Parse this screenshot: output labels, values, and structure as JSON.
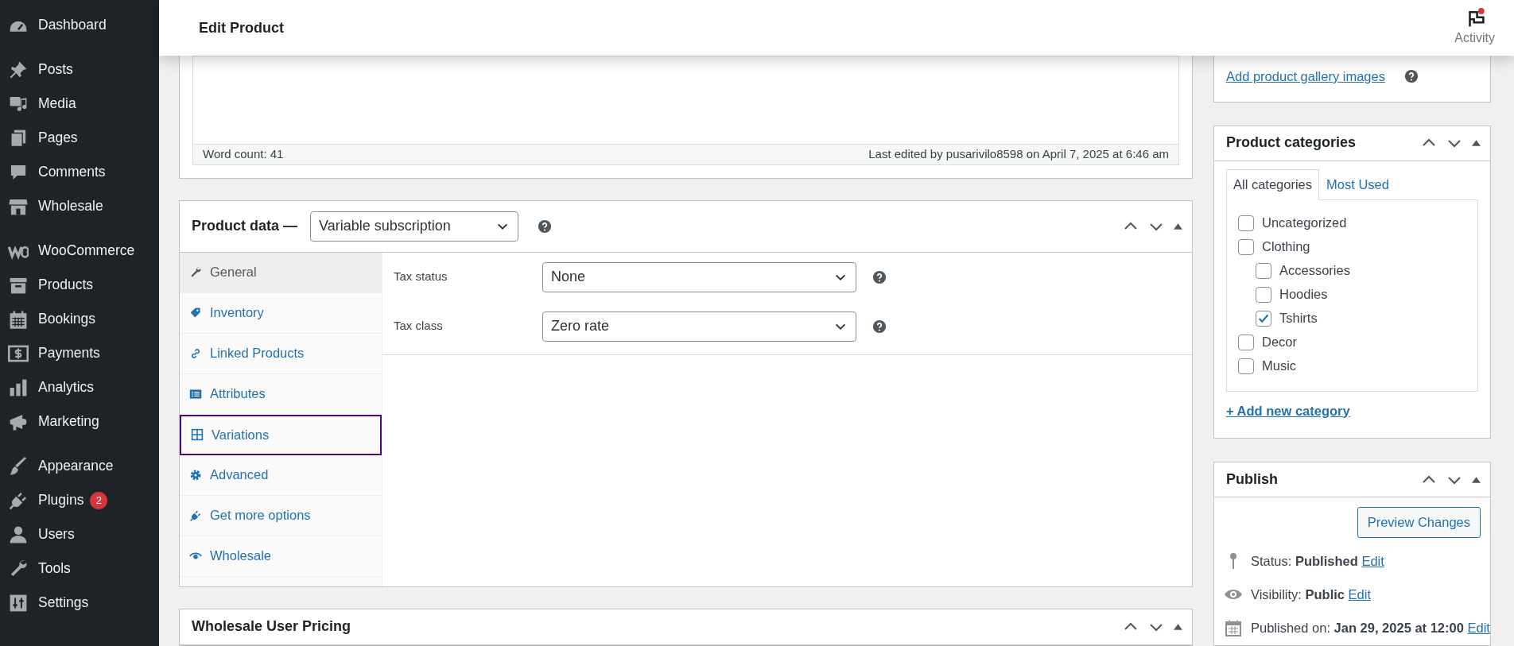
{
  "sidebar": {
    "groups": [
      {
        "items": [
          {
            "label": "Dashboard"
          }
        ]
      },
      {
        "items": [
          {
            "label": "Posts"
          },
          {
            "label": "Media"
          },
          {
            "label": "Pages"
          },
          {
            "label": "Comments"
          },
          {
            "label": "Wholesale"
          }
        ]
      },
      {
        "items": [
          {
            "label": "WooCommerce"
          },
          {
            "label": "Products"
          },
          {
            "label": "Bookings"
          },
          {
            "label": "Payments"
          },
          {
            "label": "Analytics"
          },
          {
            "label": "Marketing"
          }
        ]
      },
      {
        "items": [
          {
            "label": "Appearance"
          },
          {
            "label": "Plugins",
            "badge": "2"
          },
          {
            "label": "Users"
          },
          {
            "label": "Tools"
          },
          {
            "label": "Settings"
          }
        ]
      }
    ]
  },
  "header": {
    "title": "Edit Product",
    "activity": {
      "label": "Activity",
      "unread": true
    }
  },
  "editor": {
    "word_count": "Word count: 41",
    "last_edited": "Last edited by pusarivilo8598 on April 7, 2025 at 6:46 am"
  },
  "product_data": {
    "title": "Product data —",
    "type_select": "Variable subscription",
    "tabs": [
      {
        "label": "General",
        "selected": true,
        "focused": false
      },
      {
        "label": "Inventory",
        "selected": false,
        "focused": false
      },
      {
        "label": "Linked Products",
        "selected": false,
        "focused": false
      },
      {
        "label": "Attributes",
        "selected": false,
        "focused": false
      },
      {
        "label": "Variations",
        "selected": false,
        "focused": true
      },
      {
        "label": "Advanced",
        "selected": false,
        "focused": false
      },
      {
        "label": "Get more options",
        "selected": false,
        "focused": false
      },
      {
        "label": "Wholesale",
        "selected": false,
        "focused": false
      }
    ],
    "fields": [
      {
        "label": "Tax status",
        "value": "None"
      },
      {
        "label": "Tax class",
        "value": "Zero rate"
      }
    ]
  },
  "wholesale_pricing": {
    "title": "Wholesale User Pricing"
  },
  "gallery": {
    "link": "Add product gallery images"
  },
  "categories": {
    "title": "Product categories",
    "tabs": [
      {
        "label": "All categories",
        "selected": true
      },
      {
        "label": "Most Used",
        "selected": false
      }
    ],
    "items": [
      {
        "label": "Uncategorized",
        "checked": false
      },
      {
        "label": "Clothing",
        "checked": false,
        "children": [
          {
            "label": "Accessories",
            "checked": false
          },
          {
            "label": "Hoodies",
            "checked": false
          },
          {
            "label": "Tshirts",
            "checked": true
          }
        ]
      },
      {
        "label": "Decor",
        "checked": false
      },
      {
        "label": "Music",
        "checked": false
      }
    ],
    "add_link": "+ Add new category"
  },
  "publish": {
    "title": "Publish",
    "preview_button": "Preview Changes",
    "rows": [
      {
        "text": "Status: **Published**",
        "edit": "Edit"
      },
      {
        "text": "Visibility: **Public**",
        "edit": "Edit"
      },
      {
        "text": "Published on: **Jan 29, 2025 at 12:00**",
        "edit": "Edit"
      }
    ]
  }
}
